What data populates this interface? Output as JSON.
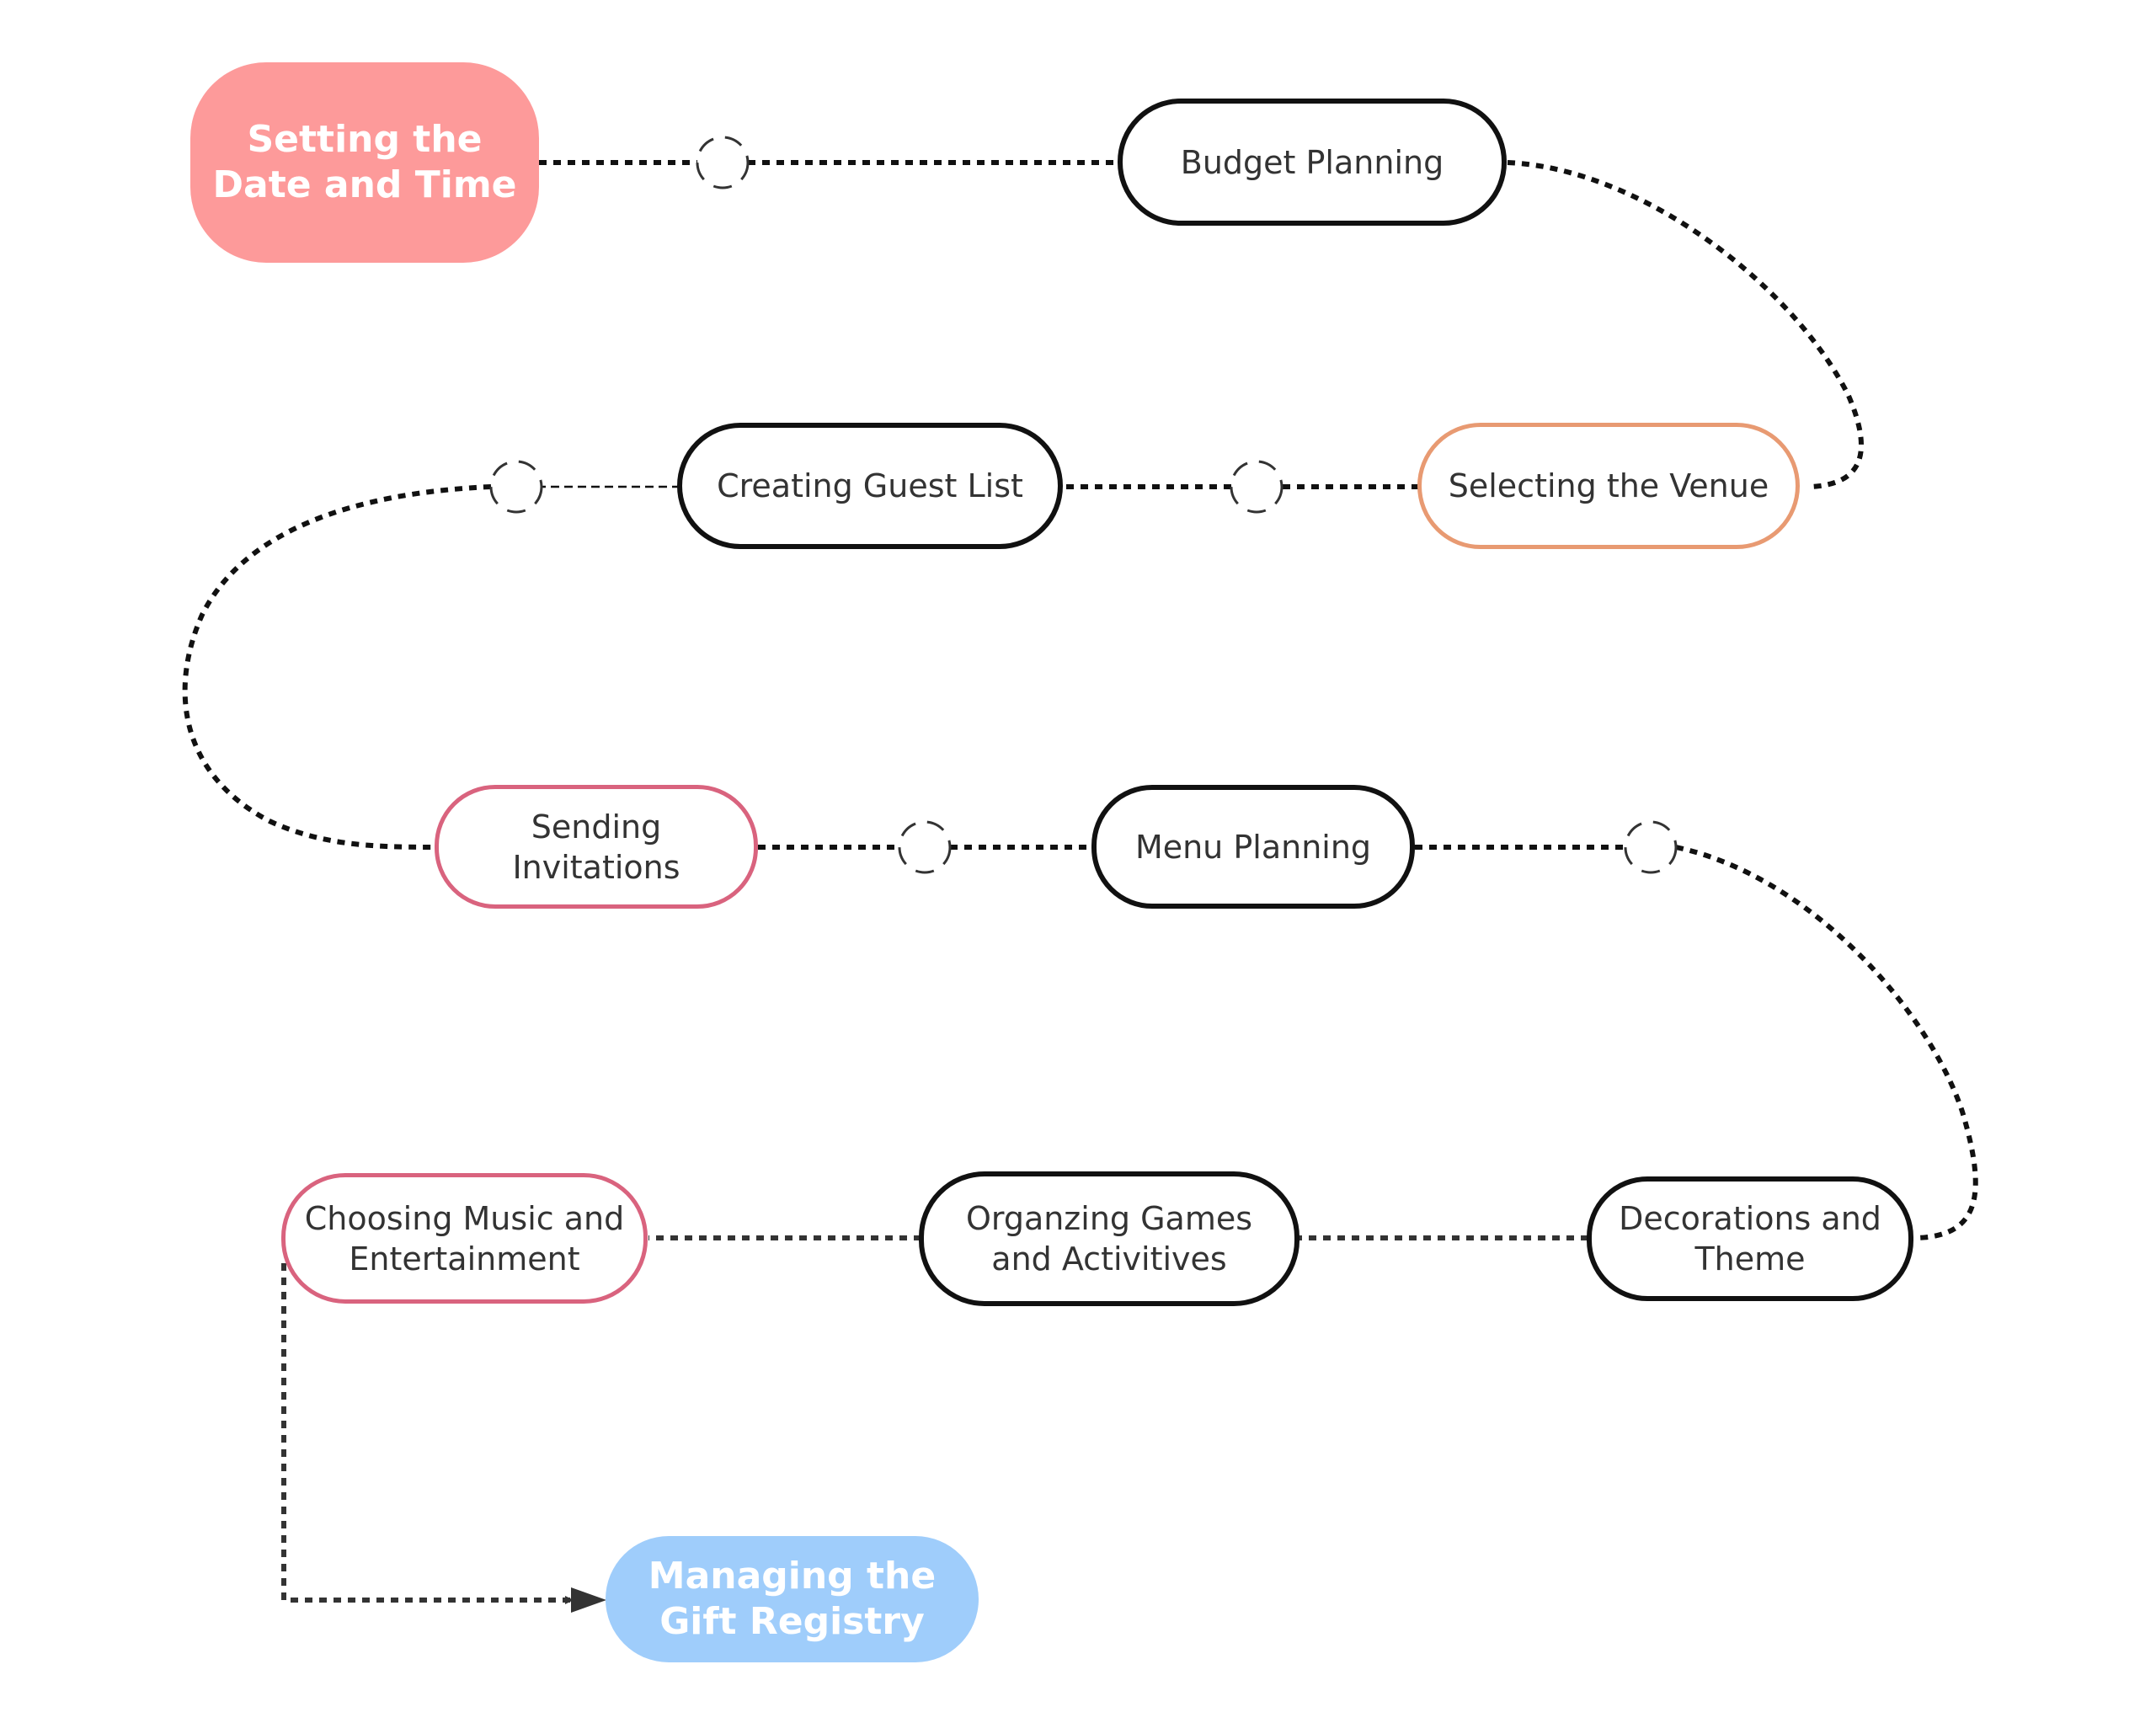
{
  "diagram": {
    "type": "flowchart",
    "colors": {
      "start_fill": "#fd9a9a",
      "end_fill": "#9fcdfb",
      "default_border": "#111111",
      "pink_border": "#d9637e",
      "orange_border": "#e89a72",
      "connector": "#111111",
      "text": "#333333"
    },
    "nodes": [
      {
        "id": "setting-date-time",
        "label": "Setting the\nDate and Time",
        "style": "start"
      },
      {
        "id": "budget-planning",
        "label": "Budget Planning",
        "style": "default"
      },
      {
        "id": "selecting-venue",
        "label": "Selecting the Venue",
        "style": "orange"
      },
      {
        "id": "creating-guest-list",
        "label": "Creating Guest List",
        "style": "default"
      },
      {
        "id": "sending-invitations",
        "label": "Sending\nInvitations",
        "style": "pink"
      },
      {
        "id": "menu-planning",
        "label": "Menu Planning",
        "style": "default"
      },
      {
        "id": "decorations-theme",
        "label": "Decorations and\nTheme",
        "style": "default"
      },
      {
        "id": "organizing-games",
        "label": "Organzing Games\nand Activitives",
        "style": "default"
      },
      {
        "id": "choosing-music",
        "label": "Choosing Music and\nEntertainment",
        "style": "pink"
      },
      {
        "id": "managing-gift-registry",
        "label": "Managing the\nGift Registry",
        "style": "end"
      }
    ],
    "edges": [
      {
        "from": "setting-date-time",
        "to": "budget-planning",
        "junction": true
      },
      {
        "from": "budget-planning",
        "to": "selecting-venue",
        "junction": false
      },
      {
        "from": "selecting-venue",
        "to": "creating-guest-list",
        "junction": true
      },
      {
        "from": "creating-guest-list",
        "to": "sending-invitations",
        "junction": true
      },
      {
        "from": "sending-invitations",
        "to": "menu-planning",
        "junction": true
      },
      {
        "from": "menu-planning",
        "to": "decorations-theme",
        "junction": true
      },
      {
        "from": "decorations-theme",
        "to": "organizing-games",
        "junction": false
      },
      {
        "from": "organizing-games",
        "to": "choosing-music",
        "junction": false
      },
      {
        "from": "choosing-music",
        "to": "managing-gift-registry",
        "junction": false,
        "arrow": true
      }
    ]
  }
}
